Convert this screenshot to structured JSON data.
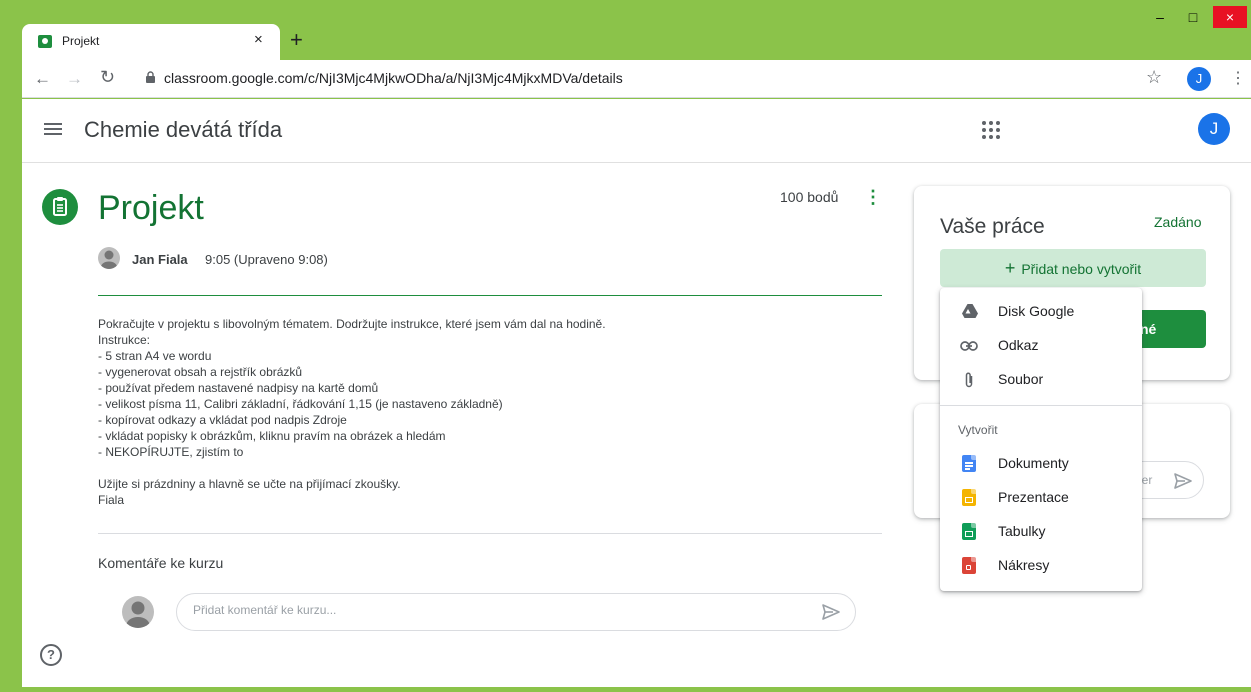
{
  "browser": {
    "tab_title": "Projekt",
    "tab_close": "×",
    "new_tab": "+",
    "url": "classroom.google.com/c/NjI3Mjc4MjkwODha/a/NjI3Mjc4MjkxMDVa/details",
    "profile_initial": "J",
    "window_controls": {
      "minimize": "–",
      "maximize": "□",
      "close": "×"
    }
  },
  "header": {
    "class_name": "Chemie devátá třída",
    "avatar_initial": "J"
  },
  "assignment": {
    "title": "Projekt",
    "points": "100 bodů",
    "author": "Jan Fiala",
    "time": "9:05 (Upraveno 9:08)",
    "description": [
      "Pokračujte v projektu s libovolným tématem. Dodržujte instrukce, které jsem vám dal na hodině.",
      "Instrukce:",
      "- 5 stran A4 ve wordu",
      "- vygenerovat obsah a rejstřík obrázků",
      "- používat předem nastavené nadpisy na kartě domů",
      "- velikost písma 11, Calibri základní, řádkování 1,15 (je nastaveno základně)",
      "- kopírovat odkazy a vkládat pod nadpis Zdroje",
      "- vkládat popisky k obrázkům, kliknu pravím na obrázek a hledám",
      "- NEKOPÍRUJTE, zjistím to",
      "",
      "Užijte si prázdniny a hlavně se učte na přijímací zkoušky.",
      "Fiala"
    ]
  },
  "comments": {
    "title": "Komentáře ke kurzu",
    "placeholder": "Přidat komentář ke kurzu..."
  },
  "your_work": {
    "title": "Vaše práce",
    "status": "Zadáno",
    "add_button": "Přidat nebo vytvořit",
    "add_plus": "+",
    "mark_done_partial": "né"
  },
  "private_comment": {
    "placeholder_partial": "ner"
  },
  "dropdown": {
    "items": [
      {
        "label": "Disk Google",
        "icon": "google-drive-icon"
      },
      {
        "label": "Odkaz",
        "icon": "link-icon"
      },
      {
        "label": "Soubor",
        "icon": "paperclip-icon"
      }
    ],
    "create_section": "Vytvořit",
    "create_items": [
      {
        "label": "Dokumenty",
        "icon": "docs-icon",
        "color": "#4285f4"
      },
      {
        "label": "Prezentace",
        "icon": "slides-icon",
        "color": "#f4b400"
      },
      {
        "label": "Tabulky",
        "icon": "sheets-icon",
        "color": "#0f9d58"
      },
      {
        "label": "Nákresy",
        "icon": "drawings-icon",
        "color": "#db4437"
      }
    ]
  },
  "colors": {
    "window_frame": "#8bc34a",
    "classroom_green": "#1e8e3e",
    "title_green": "#137333",
    "accent_blue": "#1a73e8"
  }
}
